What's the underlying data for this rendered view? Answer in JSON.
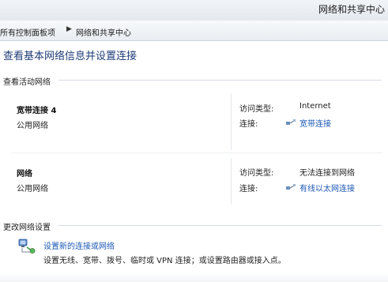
{
  "window": {
    "title": "网络和共享中心"
  },
  "address": {
    "crumbs": [
      "所有控制面板项",
      "网络和共享中心"
    ],
    "separator_icon": "chevron-right"
  },
  "page": {
    "title": "查看基本网络信息并设置连接"
  },
  "active_networks": {
    "label": "查看活动网络",
    "items": [
      {
        "name": "宽带连接 4",
        "type": "公用网络",
        "access_label": "访问类型:",
        "access_value": "Internet",
        "connection_label": "连接:",
        "connection_link": "宽带连接",
        "connection_icon": "broadband-connection-icon"
      },
      {
        "name": "网络",
        "type": "公用网络",
        "access_label": "访问类型:",
        "access_value": "无法连接到网络",
        "connection_label": "连接:",
        "connection_link": "有线以太网连接",
        "connection_icon": "ethernet-connection-icon"
      }
    ]
  },
  "change_settings": {
    "label": "更改网络设置",
    "tasks": [
      {
        "link": "设置新的连接或网络",
        "description": "设置无线、宽带、拨号、临时或 VPN 连接；或设置路由器或接入点。",
        "icon": "new-connection-icon"
      }
    ]
  },
  "colors": {
    "link": "#1c58b5",
    "title": "#1e3d78"
  }
}
